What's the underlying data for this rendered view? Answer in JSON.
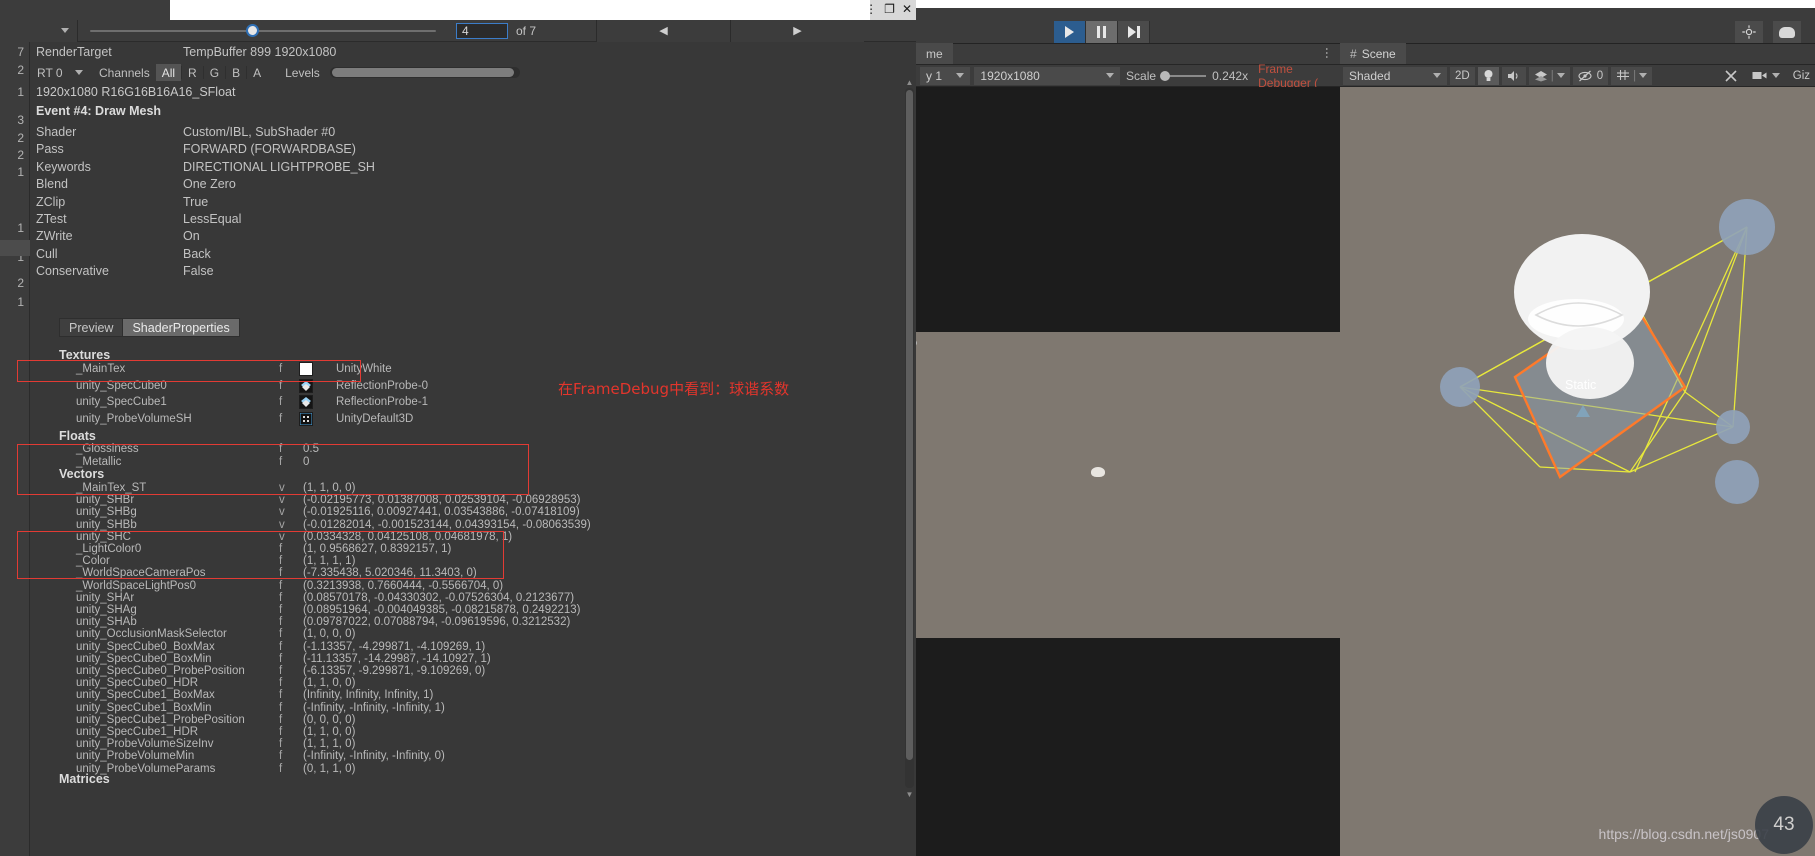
{
  "window": {
    "title_buttons": [
      "⋮",
      "□",
      "✕"
    ]
  },
  "nav": {
    "event_index": "4",
    "of_label": "of 7",
    "prev_arrow": "◀",
    "next_arrow": "▶"
  },
  "rail_numbers": [
    "7",
    "2",
    "1",
    "3",
    "2",
    "2",
    "1",
    "1",
    "1",
    "2",
    "1"
  ],
  "render_target": {
    "label": "RenderTarget",
    "value": "TempBuffer 899 1920x1080",
    "rt_selector": "RT 0",
    "channels_label": "Channels",
    "channels": [
      "All",
      "R",
      "G",
      "B",
      "A"
    ],
    "channel_selected": "All",
    "levels_label": "Levels",
    "format": "1920x1080 R16G16B16A16_SFloat"
  },
  "event": {
    "title": "Event #4: Draw Mesh",
    "rows": [
      {
        "key": "Shader",
        "value": "Custom/IBL, SubShader #0"
      },
      {
        "key": "Pass",
        "value": "FORWARD (FORWARDBASE)"
      },
      {
        "key": "Keywords",
        "value": "DIRECTIONAL LIGHTPROBE_SH"
      },
      {
        "key": "Blend",
        "value": "One Zero"
      },
      {
        "key": "ZClip",
        "value": "True"
      },
      {
        "key": "ZTest",
        "value": "LessEqual"
      },
      {
        "key": "ZWrite",
        "value": "On"
      },
      {
        "key": "Cull",
        "value": "Back"
      },
      {
        "key": "Conservative",
        "value": "False"
      }
    ]
  },
  "property_tabs": [
    {
      "label": "Preview",
      "active": false
    },
    {
      "label": "ShaderProperties",
      "active": true
    }
  ],
  "sections": {
    "textures_title": "Textures",
    "floats_title": "Floats",
    "vectors_title": "Vectors",
    "matrices_title": "Matrices"
  },
  "textures": [
    {
      "name": "_MainTex",
      "f": "f",
      "swatch": "white",
      "value": "UnityWhite"
    },
    {
      "name": "unity_SpecCube0",
      "f": "f",
      "swatch": "cube",
      "value": "ReflectionProbe-0"
    },
    {
      "name": "unity_SpecCube1",
      "f": "f",
      "swatch": "cube",
      "value": "ReflectionProbe-1"
    },
    {
      "name": "unity_ProbeVolumeSH",
      "f": "f",
      "swatch": "probe",
      "value": "UnityDefault3D"
    }
  ],
  "floats": [
    {
      "name": "_Glossiness",
      "f": "f",
      "value": "0.5"
    },
    {
      "name": "_Metallic",
      "f": "f",
      "value": "0"
    }
  ],
  "vectors": [
    {
      "name": "_MainTex_ST",
      "f": "v",
      "value": "(1, 1, 0, 0)"
    },
    {
      "name": "unity_SHBr",
      "f": "v",
      "value": "(-0.02195773, 0.01387008, 0.02539104, -0.06928953)"
    },
    {
      "name": "unity_SHBg",
      "f": "v",
      "value": "(-0.01925116, 0.00927441, 0.03543886, -0.07418109)"
    },
    {
      "name": "unity_SHBb",
      "f": "v",
      "value": "(-0.01282014, -0.001523144, 0.04393154, -0.08063539)"
    },
    {
      "name": "unity_SHC",
      "f": "v",
      "value": "(0.0334328, 0.04125108, 0.04681978, 1)"
    },
    {
      "name": "_LightColor0",
      "f": "f",
      "value": "(1, 0.9568627, 0.8392157, 1)"
    },
    {
      "name": "_Color",
      "f": "f",
      "value": "(1, 1, 1, 1)"
    },
    {
      "name": "_WorldSpaceCameraPos",
      "f": "f",
      "value": "(-7.335438, 5.020346, 11.3403, 0)"
    },
    {
      "name": "_WorldSpaceLightPos0",
      "f": "f",
      "value": "(0.3213938, 0.7660444, -0.5566704, 0)"
    },
    {
      "name": "unity_SHAr",
      "f": "f",
      "value": "(0.08570178, -0.04330302, -0.07526304, 0.2123677)"
    },
    {
      "name": "unity_SHAg",
      "f": "f",
      "value": "(0.08951964, -0.004049385, -0.08215878, 0.2492213)"
    },
    {
      "name": "unity_SHAb",
      "f": "f",
      "value": "(0.09787022, 0.07088794, -0.09619596, 0.3212532)"
    },
    {
      "name": "unity_OcclusionMaskSelector",
      "f": "f",
      "value": "(1, 0, 0, 0)"
    },
    {
      "name": "unity_SpecCube0_BoxMax",
      "f": "f",
      "value": "(-1.13357, -4.299871, -4.109269, 1)"
    },
    {
      "name": "unity_SpecCube0_BoxMin",
      "f": "f",
      "value": "(-11.13357, -14.29987, -14.10927, 1)"
    },
    {
      "name": "unity_SpecCube0_ProbePosition",
      "f": "f",
      "value": "(-6.13357, -9.299871, -9.109269, 0)"
    },
    {
      "name": "unity_SpecCube0_HDR",
      "f": "f",
      "value": "(1, 1, 0, 0)"
    },
    {
      "name": "unity_SpecCube1_BoxMax",
      "f": "f",
      "value": "(Infinity, Infinity, Infinity, 1)"
    },
    {
      "name": "unity_SpecCube1_BoxMin",
      "f": "f",
      "value": "(-Infinity, -Infinity, -Infinity, 1)"
    },
    {
      "name": "unity_SpecCube1_ProbePosition",
      "f": "f",
      "value": "(0, 0, 0, 0)"
    },
    {
      "name": "unity_SpecCube1_HDR",
      "f": "f",
      "value": "(1, 1, 0, 0)"
    },
    {
      "name": "unity_ProbeVolumeSizeInv",
      "f": "f",
      "value": "(1, 1, 1, 0)"
    },
    {
      "name": "unity_ProbeVolumeMin",
      "f": "f",
      "value": "(-Infinity, -Infinity, -Infinity, 0)"
    },
    {
      "name": "unity_ProbeVolumeParams",
      "f": "f",
      "value": "(0, 1, 1, 0)"
    }
  ],
  "annotation": {
    "text": "在FrameDebug中看到：球谐系数",
    "color": "#e2352c"
  },
  "game_view": {
    "tab_label": "me",
    "display": "y 1",
    "resolution": "1920x1080",
    "scale_label": "Scale",
    "scale_value": "0.242x",
    "frame_debugger_label": "Frame Debugger ("
  },
  "scene_view": {
    "tab_label": "Scene",
    "draw_mode": "Shaded",
    "two_d": "2D",
    "audio_count": "0",
    "gizmos_label": "Giz",
    "static_label": "Static",
    "watermark": "https://blog.csdn.net/js0907",
    "gizmo_label": "43"
  },
  "colors": {
    "accent_blue": "#2c5d8f",
    "highlight_red": "#e23b34",
    "panel_bg": "#383838",
    "toolbar_bg": "#3c3c3c",
    "scene_bg": "#7f7870",
    "probe_yellow": "#e8e83c",
    "selection_orange": "#ff7a2a"
  }
}
